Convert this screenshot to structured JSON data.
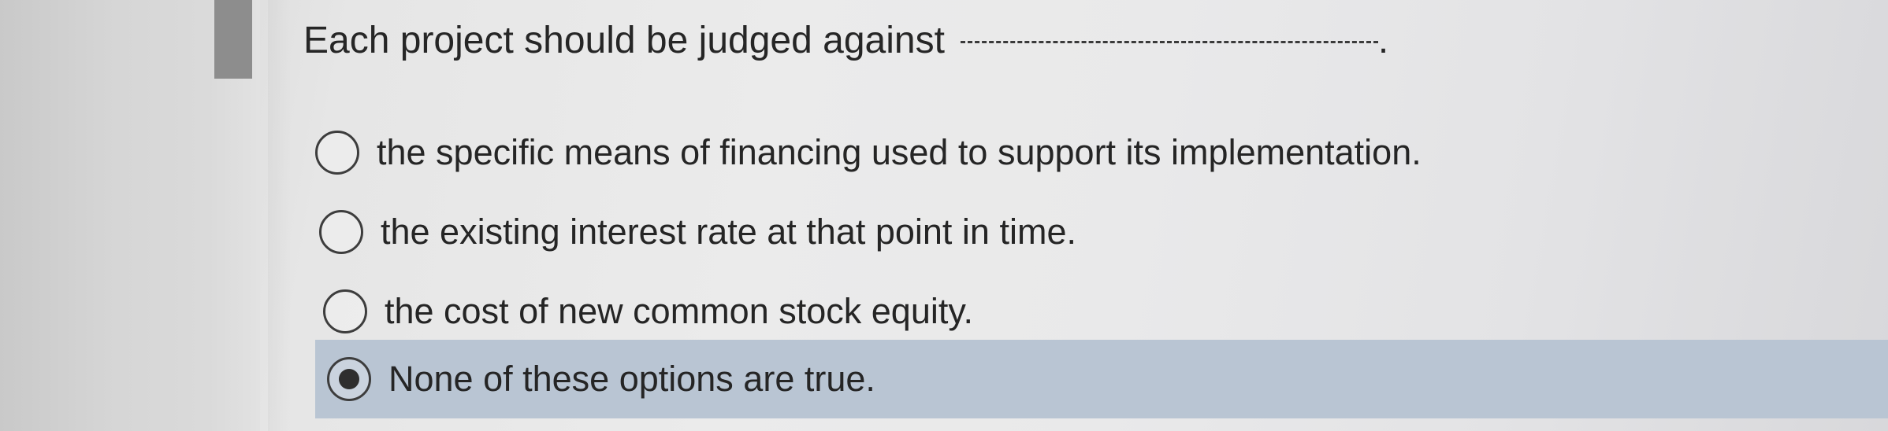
{
  "question": {
    "text": "Each project should be judged against",
    "end_punct": "."
  },
  "options": [
    {
      "label": "the specific means of financing used to support its implementation.",
      "selected": false
    },
    {
      "label": "the existing interest rate at that point in time.",
      "selected": false
    },
    {
      "label": "the cost of new common stock equity.",
      "selected": false
    },
    {
      "label": "None of these options are true.",
      "selected": true
    }
  ],
  "colors": {
    "selected_row_bg": "#b9c5d3",
    "text": "#252525"
  }
}
